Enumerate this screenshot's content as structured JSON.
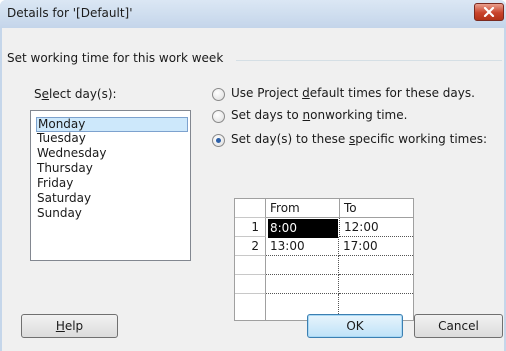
{
  "window": {
    "title": "Details for '[Default]'"
  },
  "group": {
    "title": "Set working time for this work week"
  },
  "days": {
    "label_pre": "S",
    "label_u": "e",
    "label_post": "lect day(s):",
    "items": [
      "Monday",
      "Tuesday",
      "Wednesday",
      "Thursday",
      "Friday",
      "Saturday",
      "Sunday"
    ],
    "selected": "Monday"
  },
  "options": [
    {
      "pre": "Use Project ",
      "u": "d",
      "post": "efault times for these days.",
      "checked": false
    },
    {
      "pre": "Set days to ",
      "u": "n",
      "post": "onworking time.",
      "checked": false
    },
    {
      "pre": "Set day(s) to these ",
      "u": "s",
      "post": "pecific working times:",
      "checked": true
    }
  ],
  "grid": {
    "headers": {
      "from": "From",
      "to": "To"
    },
    "rows": [
      {
        "num": "1",
        "from": "8:00",
        "to": "12:00"
      },
      {
        "num": "2",
        "from": "13:00",
        "to": "17:00"
      }
    ]
  },
  "buttons": {
    "help_u": "H",
    "help_rest": "elp",
    "ok": "OK",
    "cancel": "Cancel"
  }
}
